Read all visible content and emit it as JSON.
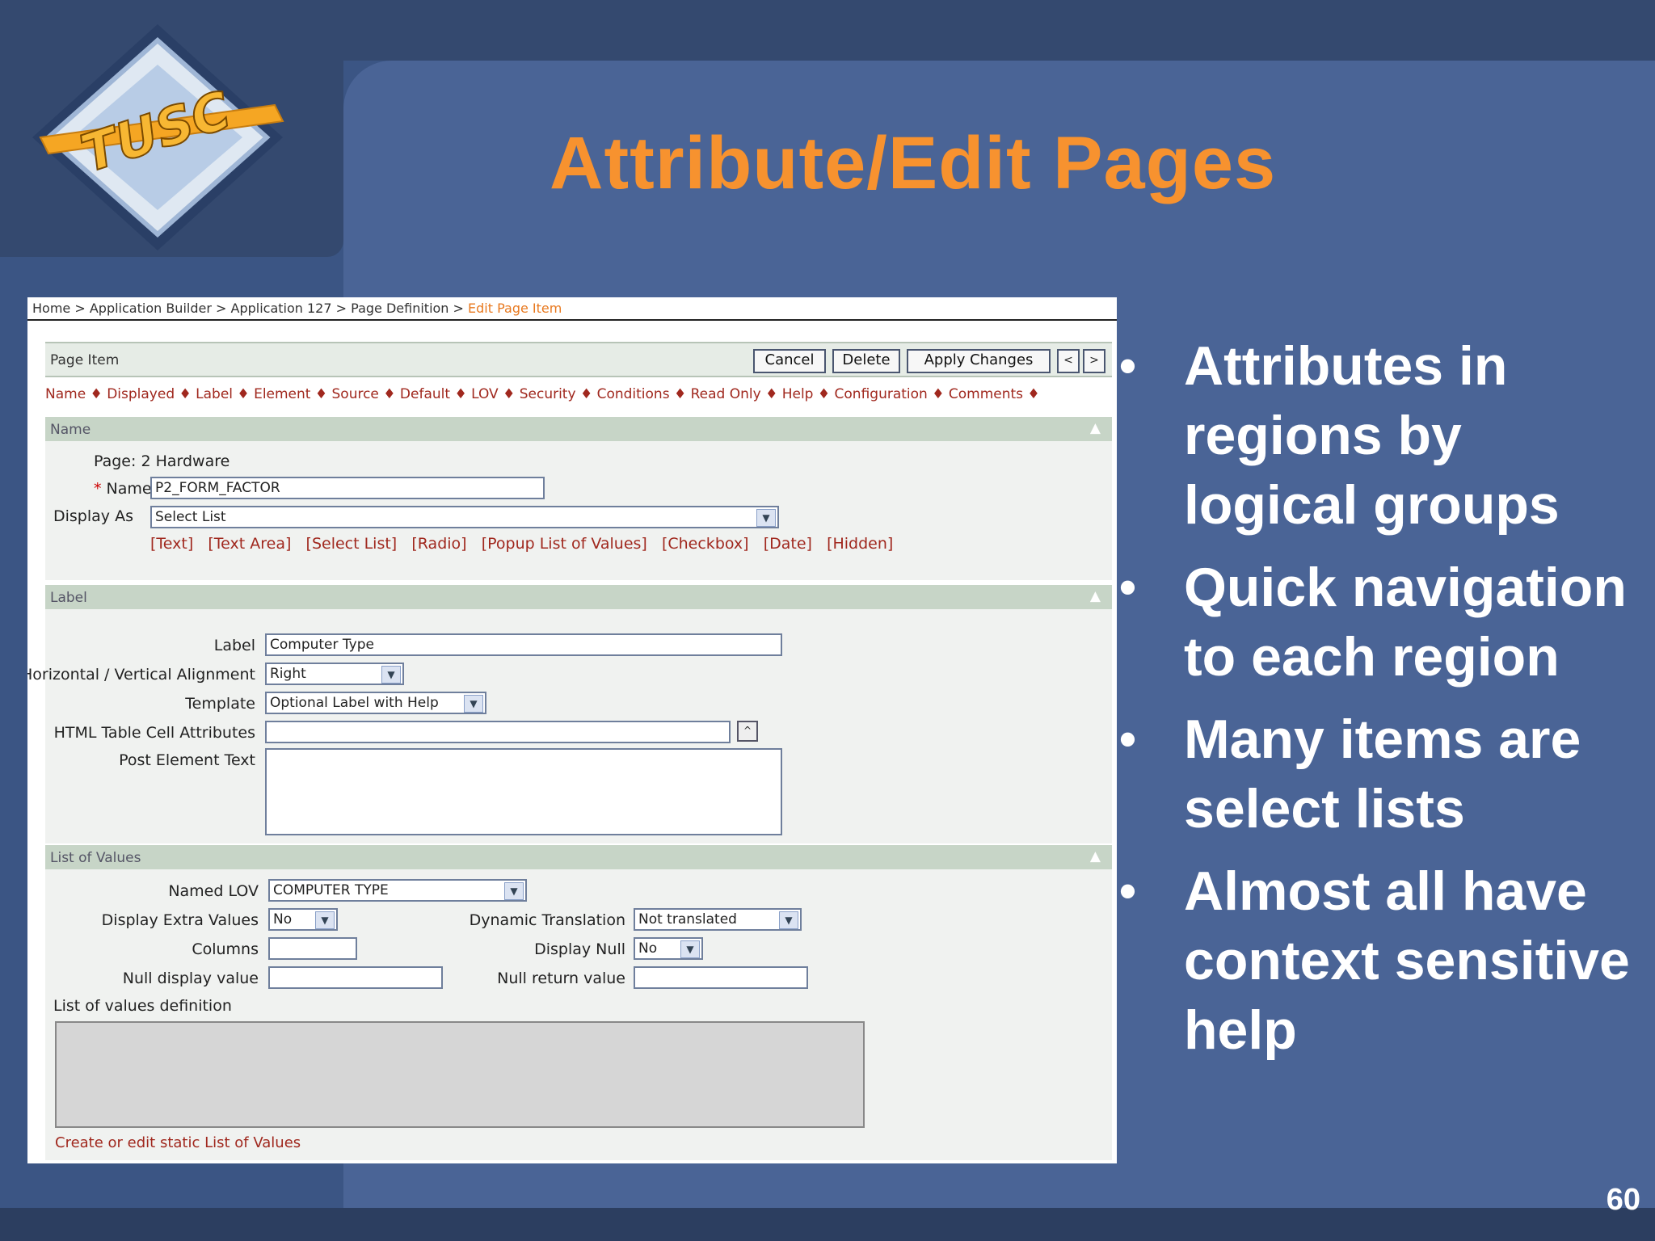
{
  "slide": {
    "title": "Attribute/Edit Pages",
    "logo_text": "TUSC",
    "page_number": "60",
    "bullets": [
      "Attributes in regions by logical groups",
      "Quick navigation to each region",
      "Many items are select lists",
      "Almost all have context sensitive help"
    ]
  },
  "colors": {
    "title": "#f7922f",
    "background": "#3b5584",
    "link_red": "#a0281e"
  },
  "screenshot": {
    "breadcrumb": {
      "home": "Home",
      "application_builder": "Application Builder",
      "application": "Application 127",
      "page_definition": "Page Definition",
      "current": "Edit Page Item",
      "separator": ">"
    },
    "header": {
      "label": "Page Item",
      "cancel": "Cancel",
      "delete": "Delete",
      "apply": "Apply Changes",
      "prev": "<",
      "next": ">"
    },
    "region_links": "Name ♦ Displayed ♦ Label ♦ Element ♦ Source ♦ Default ♦ LOV ♦ Security ♦ Conditions ♦ Read Only ♦ Help ♦ Configuration ♦ Comments ♦",
    "name_region": {
      "title": "Name",
      "page_label": "Page: 2 Hardware",
      "name_label": "Name",
      "name_value": "P2_FORM_FACTOR",
      "display_as_label": "Display As",
      "display_as_value": "Select List",
      "type_links": [
        "[Text]",
        "[Text Area]",
        "[Select List]",
        "[Radio]",
        "[Popup List of Values]",
        "[Checkbox]",
        "[Date]",
        "[Hidden]"
      ]
    },
    "label_region": {
      "title": "Label",
      "label_label": "Label",
      "label_value": "Computer Type",
      "alignment_label": "Horizontal / Vertical Alignment",
      "alignment_value": "Right",
      "template_label": "Template",
      "template_value": "Optional Label with Help",
      "cell_attr_label": "HTML Table Cell Attributes",
      "cell_attr_value": "",
      "post_text_label": "Post Element Text"
    },
    "lov_region": {
      "title": "List of Values",
      "named_lov_label": "Named LOV",
      "named_lov_value": "COMPUTER TYPE",
      "extra_values_label": "Display Extra Values",
      "extra_values_value": "No",
      "dynamic_translation_label": "Dynamic Translation",
      "dynamic_translation_value": "Not translated",
      "columns_label": "Columns",
      "columns_value": "",
      "display_null_label": "Display Null",
      "display_null_value": "No",
      "null_display_label": "Null display value",
      "null_display_value": "",
      "null_return_label": "Null return value",
      "null_return_value": "",
      "lov_definition_label": "List of values definition",
      "create_link": "Create or edit static List of Values"
    }
  }
}
